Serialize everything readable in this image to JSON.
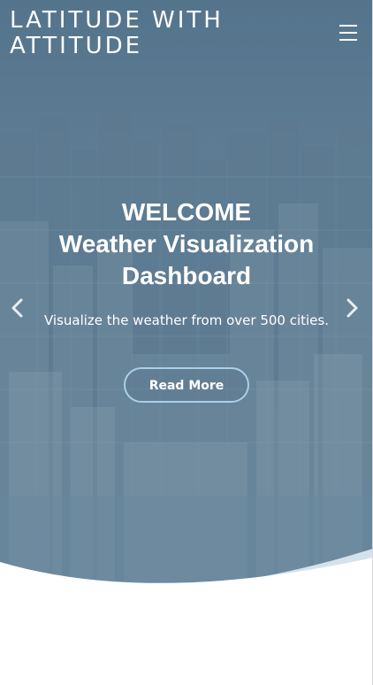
{
  "header": {
    "brand": "LATITUDE WITH ATTITUDE",
    "menu_icon": "hamburger-menu-icon"
  },
  "hero": {
    "title_line1": "WELCOME",
    "title_line2": "Weather Visualization",
    "title_line3": "Dashboard",
    "subtitle": "Visualize the weather from over 500 cities.",
    "button_label": "Read More",
    "prev_icon": "chevron-left-icon",
    "next_icon": "chevron-right-icon"
  },
  "colors": {
    "accent_border": "#a9d0e8",
    "curve_light": "#d3e3ed",
    "text": "#ffffff"
  }
}
